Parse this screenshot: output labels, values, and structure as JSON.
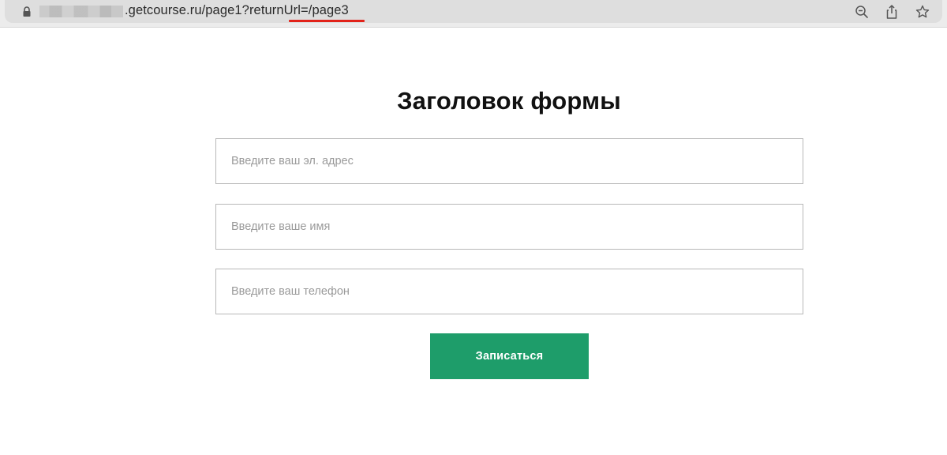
{
  "browser": {
    "url_text": ".getcourse.ru/page1?returnUrl=/page3",
    "icons": {
      "lock": "lock-icon",
      "zoom": "zoom-out-icon",
      "share": "share-icon",
      "bookmark": "star-icon"
    },
    "colors": {
      "underline": "#e2231a"
    }
  },
  "form": {
    "title": "Заголовок формы",
    "fields": {
      "email": {
        "placeholder": "Введите ваш эл. адрес"
      },
      "name": {
        "placeholder": "Введите ваше имя"
      },
      "phone": {
        "placeholder": "Введите ваш телефон"
      }
    },
    "submit_label": "Записаться",
    "colors": {
      "button": "#1e9d6a",
      "button_text": "#ffffff"
    }
  }
}
